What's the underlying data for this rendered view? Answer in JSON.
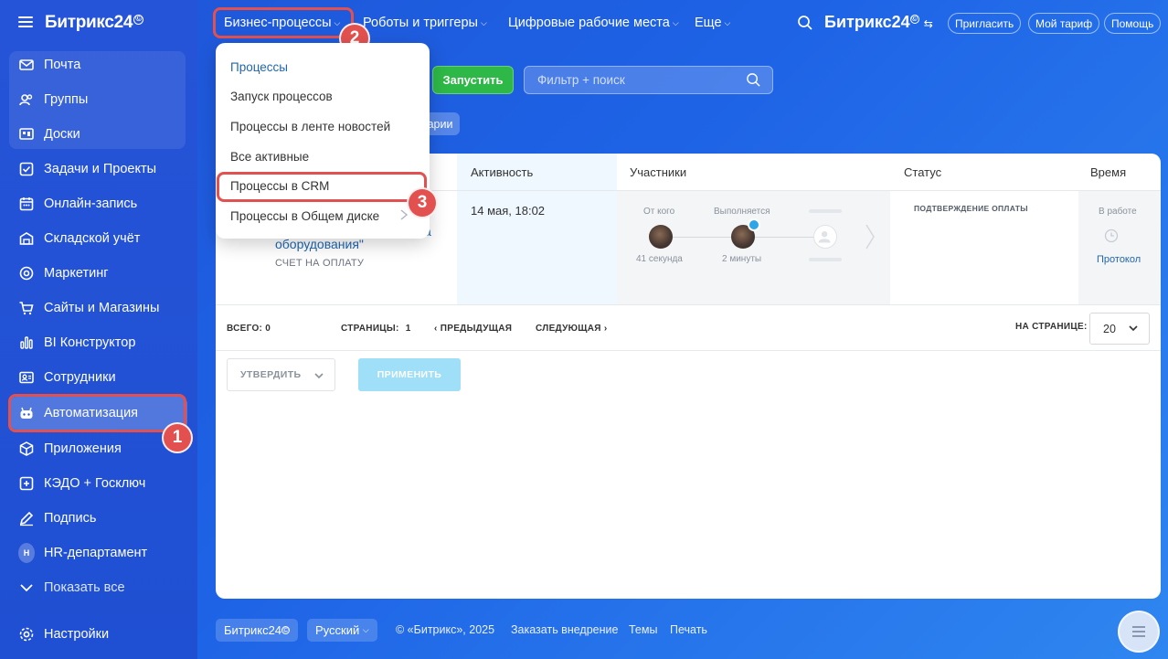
{
  "sidebar": {
    "logo": "Битрикс24",
    "logo_mark": "©",
    "items": [
      {
        "label": "Почта",
        "icon": "mail-icon"
      },
      {
        "label": "Группы",
        "icon": "groups-icon"
      },
      {
        "label": "Доски",
        "icon": "boards-icon"
      },
      {
        "label": "Задачи и Проекты",
        "icon": "tasks-icon"
      },
      {
        "label": "Онлайн-запись",
        "icon": "calendar-icon"
      },
      {
        "label": "Складской учёт",
        "icon": "warehouse-icon"
      },
      {
        "label": "Маркетинг",
        "icon": "marketing-icon"
      },
      {
        "label": "Сайты и Магазины",
        "icon": "cart-icon"
      },
      {
        "label": "BI Конструктор",
        "icon": "bi-icon"
      },
      {
        "label": "Сотрудники",
        "icon": "employees-icon"
      },
      {
        "label": "Автоматизация",
        "icon": "robot-icon"
      },
      {
        "label": "Приложения",
        "icon": "box-icon"
      },
      {
        "label": "КЭДО + Госключ",
        "icon": "kedo-icon"
      },
      {
        "label": "Подпись",
        "icon": "signature-icon"
      },
      {
        "label": "HR-департамент",
        "icon": "hr-avatar",
        "avatar_text": "H"
      },
      {
        "label": "Показать все",
        "icon": "chevron-down-icon"
      }
    ],
    "settings": "Настройки"
  },
  "topbar": {
    "menu": [
      "Бизнес-процессы",
      "Роботы и триггеры",
      "Цифровые рабочие места",
      "Еще"
    ],
    "brand": "Битрикс24",
    "brand_mark": "©",
    "invite": "Пригласить",
    "tariff": "Мой тариф",
    "help": "Помощь"
  },
  "toolbar": {
    "run": "Запустить",
    "filter_placeholder": "Фильтр + поиск",
    "tag": "тарии"
  },
  "dropdown": {
    "items": [
      "Процессы",
      "Запуск процессов",
      "Процессы в ленте новостей",
      "Все активные",
      "Процессы в CRM",
      "Процессы в Общем диске"
    ]
  },
  "table": {
    "headers": {
      "activity": "Активность",
      "participants": "Участники",
      "status": "Статус",
      "time": "Время"
    },
    "row": {
      "title": "оборудования\"",
      "title_prefix": "а",
      "subtitle": "СЧЕТ НА ОПЛАТУ",
      "activity": "14 мая, 18:02",
      "from_label": "От кого",
      "from_time": "41 секунда",
      "exec_label": "Выполняется",
      "exec_time": "2 минуты",
      "status": "ПОДТВЕРЖДЕНИЕ ОПЛАТЫ",
      "time_label": "В работе",
      "protocol": "Протокол"
    }
  },
  "pagination": {
    "total_label": "ВСЕГО:",
    "total": "0",
    "pages_label": "СТРАНИЦЫ:",
    "page": "1",
    "prev": "ПРЕДЫДУЩАЯ",
    "next": "СЛЕДУЮЩАЯ",
    "per_page_label": "НА СТРАНИЦЕ:",
    "per_page": "20"
  },
  "actions": {
    "approve": "УТВЕРДИТЬ",
    "apply": "ПРИМЕНИТЬ"
  },
  "footer": {
    "brand": "Битрикс24",
    "brand_mark": "©",
    "language": "Русский",
    "copyright": "© «Битрикс», 2025",
    "order": "Заказать внедрение",
    "themes": "Темы",
    "print": "Печать"
  },
  "annotations": {
    "one": "1",
    "two": "2",
    "three": "3"
  },
  "colors": {
    "accent_red": "#e2514f",
    "run_green": "#2eb847",
    "link_blue": "#2067b0"
  }
}
